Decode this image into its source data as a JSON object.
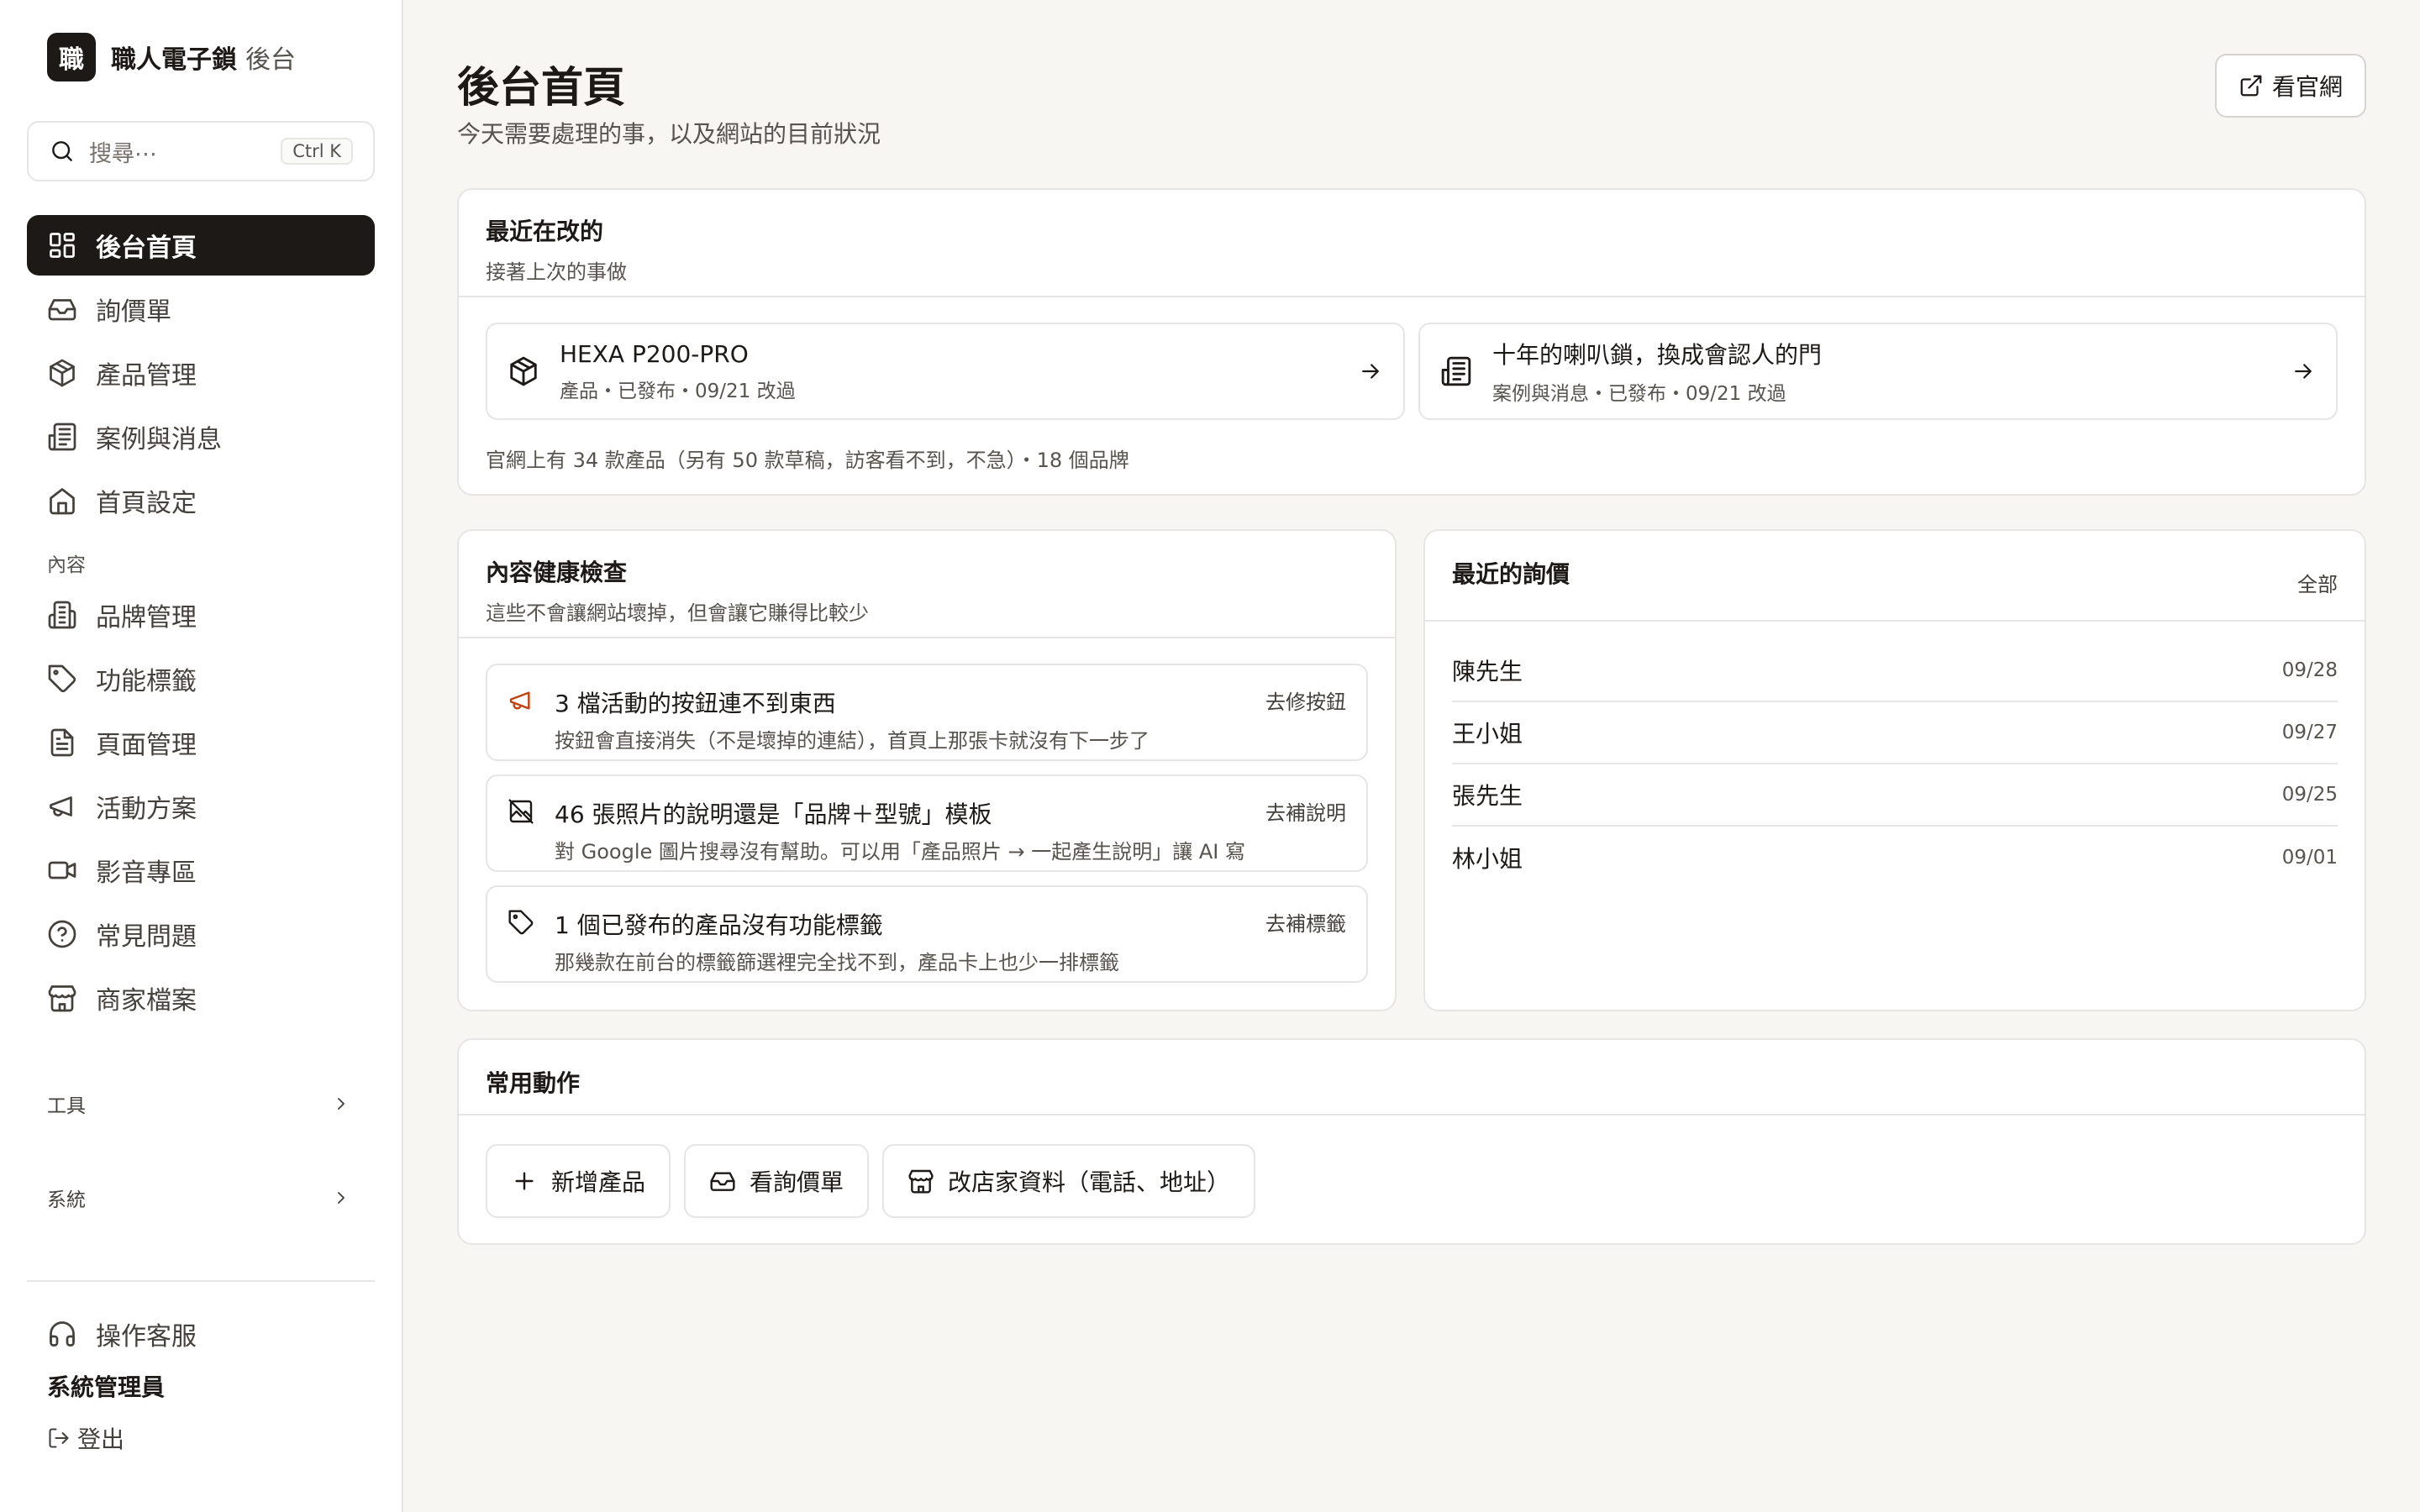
{
  "brand": {
    "logo_char": "職",
    "name": "職人電子鎖",
    "suffix": "後台"
  },
  "search": {
    "placeholder": "搜尋⋯",
    "shortcut": "Ctrl K"
  },
  "nav_main": [
    {
      "label": "後台首頁",
      "icon": "dashboard-icon",
      "active": true
    },
    {
      "label": "詢價單",
      "icon": "inbox-icon"
    },
    {
      "label": "產品管理",
      "icon": "package-icon"
    },
    {
      "label": "案例與消息",
      "icon": "newspaper-icon"
    },
    {
      "label": "首頁設定",
      "icon": "home-icon"
    }
  ],
  "section_content": "內容",
  "nav_content": [
    {
      "label": "品牌管理",
      "icon": "building-icon"
    },
    {
      "label": "功能標籤",
      "icon": "tag-icon"
    },
    {
      "label": "頁面管理",
      "icon": "file-icon"
    },
    {
      "label": "活動方案",
      "icon": "megaphone-icon"
    },
    {
      "label": "影音專區",
      "icon": "video-icon"
    },
    {
      "label": "常見問題",
      "icon": "help-circle-icon"
    },
    {
      "label": "商家檔案",
      "icon": "store-icon"
    }
  ],
  "section_tools": "工具",
  "section_system": "系統",
  "support": "操作客服",
  "admin_name": "系統管理員",
  "logout": "登出",
  "page": {
    "title": "後台首頁",
    "subtitle": "今天需要處理的事，以及網站的目前狀況",
    "visit_site": "看官網"
  },
  "recent": {
    "title": "最近在改的",
    "desc": "接著上次的事做",
    "items": [
      {
        "title": "HEXA P200-PRO",
        "meta": "產品・已發布・09/21 改過",
        "icon": "package-icon"
      },
      {
        "title": "十年的喇叭鎖，換成會認人的門",
        "meta": "案例與消息・已發布・09/21 改過",
        "icon": "newspaper-icon"
      }
    ],
    "summary": "官網上有 34 款產品（另有 50 款草稿，訪客看不到，不急）・18 個品牌"
  },
  "health": {
    "title": "內容健康檢查",
    "desc": "這些不會讓網站壞掉，但會讓它賺得比較少",
    "items": [
      {
        "title": "3 檔活動的按鈕連不到東西",
        "desc": "按鈕會直接消失（不是壞掉的連結），首頁上那張卡就沒有下一步了",
        "action": "去修按鈕",
        "icon": "megaphone-icon",
        "color": "#c2410c"
      },
      {
        "title": "46 張照片的說明還是「品牌＋型號」模板",
        "desc": "對 Google 圖片搜尋沒有幫助。可以用「產品照片 → 一起產生說明」讓 AI 寫",
        "action": "去補說明",
        "icon": "image-off-icon",
        "color": "#44403c"
      },
      {
        "title": "1 個已發布的產品沒有功能標籤",
        "desc": "那幾款在前台的標籤篩選裡完全找不到，產品卡上也少一排標籤",
        "action": "去補標籤",
        "icon": "tag-icon",
        "color": "#44403c"
      }
    ]
  },
  "inquiries": {
    "title": "最近的詢價",
    "all": "全部",
    "rows": [
      {
        "name": "陳先生",
        "date": "09/28"
      },
      {
        "name": "王小姐",
        "date": "09/27"
      },
      {
        "name": "張先生",
        "date": "09/25"
      },
      {
        "name": "林小姐",
        "date": "09/01"
      }
    ]
  },
  "actions": {
    "title": "常用動作",
    "buttons": [
      {
        "label": "新增產品",
        "icon": "plus-icon"
      },
      {
        "label": "看詢價單",
        "icon": "inbox-icon"
      },
      {
        "label": "改店家資料（電話、地址）",
        "icon": "store-icon"
      }
    ]
  }
}
